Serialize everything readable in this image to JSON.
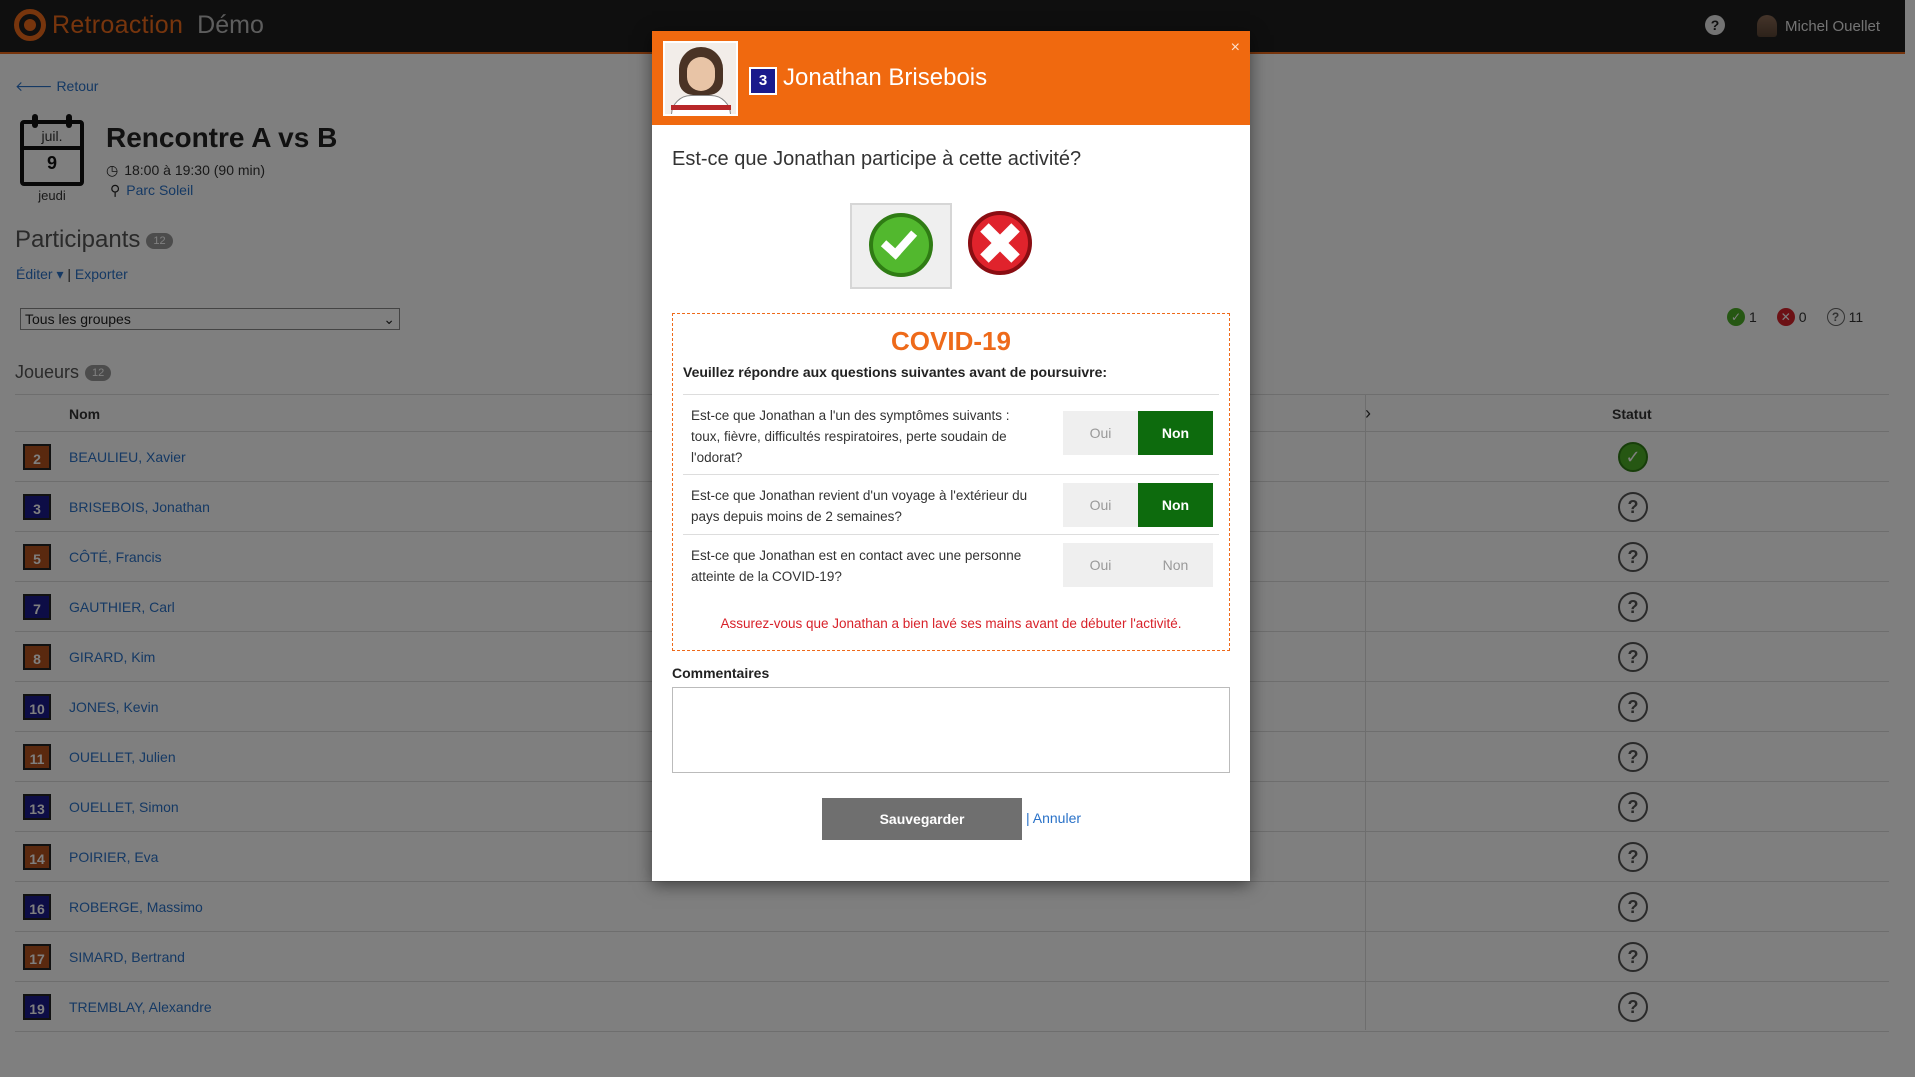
{
  "app": {
    "name": "Retroaction",
    "edition": "Démo",
    "user_name": "Michel Ouellet"
  },
  "nav": {
    "back_label": "Retour"
  },
  "event": {
    "month": "juil.",
    "day": "9",
    "weekday": "jeudi",
    "title": "Rencontre A vs B",
    "time": "18:00 à 19:30 (90 min)",
    "place": "Parc Soleil"
  },
  "participants": {
    "title": "Participants",
    "count": "12",
    "edit_label": "Éditer",
    "separator": "|",
    "export_label": "Exporter",
    "group_select": "Tous les groupes",
    "summary": {
      "present": "1",
      "absent": "0",
      "unknown": "11"
    },
    "players_title": "Joueurs",
    "players_count": "12"
  },
  "table": {
    "col_name": "Nom",
    "col_status": "Statut",
    "rows": [
      {
        "number": "2",
        "name": "BEAULIEU, Xavier",
        "color": "#b5531f",
        "status": "present"
      },
      {
        "number": "3",
        "name": "BRISEBOIS, Jonathan",
        "color": "#1a1a8c",
        "status": "unknown"
      },
      {
        "number": "5",
        "name": "CÔTÉ, Francis",
        "color": "#b5531f",
        "status": "unknown"
      },
      {
        "number": "7",
        "name": "GAUTHIER, Carl",
        "color": "#1a1a8c",
        "status": "unknown"
      },
      {
        "number": "8",
        "name": "GIRARD, Kim",
        "color": "#b5531f",
        "status": "unknown"
      },
      {
        "number": "10",
        "name": "JONES, Kevin",
        "color": "#1a1a8c",
        "status": "unknown"
      },
      {
        "number": "11",
        "name": "OUELLET, Julien",
        "color": "#b5531f",
        "status": "unknown"
      },
      {
        "number": "13",
        "name": "OUELLET, Simon",
        "color": "#1a1a8c",
        "status": "unknown"
      },
      {
        "number": "14",
        "name": "POIRIER, Eva",
        "color": "#b5531f",
        "status": "unknown"
      },
      {
        "number": "16",
        "name": "ROBERGE, Massimo",
        "color": "#1a1a8c",
        "status": "unknown"
      },
      {
        "number": "17",
        "name": "SIMARD, Bertrand",
        "color": "#b5531f",
        "status": "unknown"
      },
      {
        "number": "19",
        "name": "TREMBLAY, Alexandre",
        "color": "#1a1a8c",
        "status": "unknown"
      }
    ]
  },
  "modal": {
    "player_number": "3",
    "player_name": "Jonathan Brisebois",
    "close_label": "×",
    "question": "Est-ce que Jonathan participe à cette activité?",
    "selected_choice": "yes",
    "covid": {
      "title": "COVID-19",
      "subtitle": "Veuillez répondre aux questions suivantes avant de poursuivre:",
      "questions": [
        {
          "text": "Est-ce que Jonathan a l'un des symptômes suivants : toux, fièvre, difficultés respiratoires, perte soudain de l'odorat?",
          "yes": "Oui",
          "no": "Non",
          "answer": "no"
        },
        {
          "text": "Est-ce que Jonathan revient d'un voyage à l'extérieur du pays depuis moins de 2 semaines?",
          "yes": "Oui",
          "no": "Non",
          "answer": "no"
        },
        {
          "text": "Est-ce que Jonathan est en contact avec une personne atteinte de la COVID-19?",
          "yes": "Oui",
          "no": "Non",
          "answer": ""
        }
      ],
      "warning": "Assurez-vous que Jonathan a bien lavé ses mains avant de débuter l'activité."
    },
    "comments_label": "Commentaires",
    "comments_value": "",
    "save_label": "Sauvegarder",
    "cancel_separator": "|",
    "cancel_label": "Annuler"
  },
  "colors": {
    "accent": "#ee6a1a",
    "header_bg": "#f0690f",
    "on_green": "#0d6b0d",
    "warning": "#d8222a",
    "link": "#2a72c8"
  }
}
